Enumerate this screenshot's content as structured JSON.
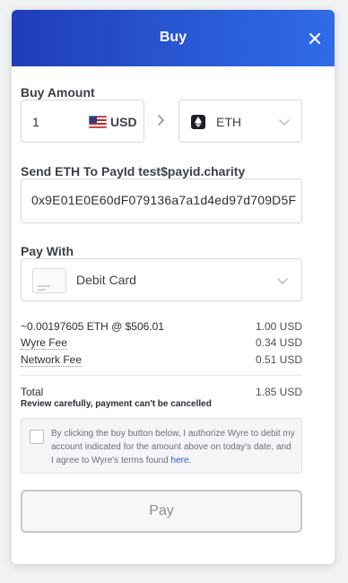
{
  "header": {
    "title": "Buy"
  },
  "buy_amount": {
    "label": "Buy Amount",
    "value": "1",
    "currency": "USD",
    "asset": "ETH"
  },
  "send_to": {
    "label": "Send ETH To PayId test$payid.charity",
    "address": "0x9E01E0E60dF079136a7a1d4ed97d709D5F"
  },
  "pay_with": {
    "label": "Pay With",
    "method": "Debit Card"
  },
  "summary": [
    {
      "label": "~0.00197605 ETH @ $506.01",
      "value": "1.00 USD"
    },
    {
      "label": "Wyre Fee",
      "value": "0.34 USD"
    },
    {
      "label": "Network Fee",
      "value": "0.51 USD"
    }
  ],
  "total": {
    "label": "Total",
    "value": "1.85 USD"
  },
  "warning": "Review carefully, payment can't be cancelled",
  "consent": {
    "text": "By clicking the buy button below, I authorize Wyre to debit my account indicated for the amount above on today's date, and I agree to Wyre's terms found ",
    "link": "here.",
    "checked": false
  },
  "buy_button": {
    "label": "Pay"
  },
  "colors": {
    "header_start": "#1f3db8",
    "header_end": "#2f6be8",
    "link": "#2a5ad6"
  }
}
